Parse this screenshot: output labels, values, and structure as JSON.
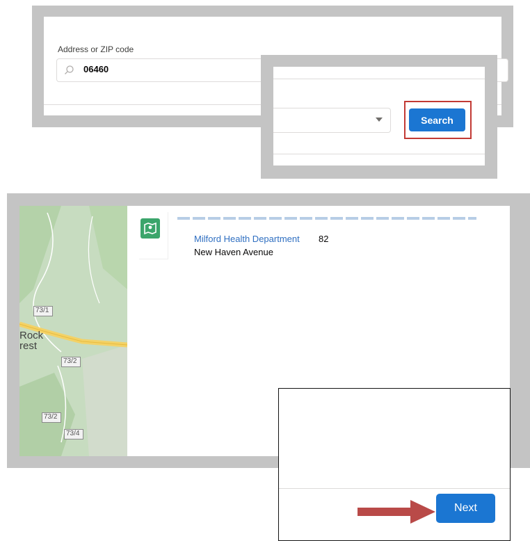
{
  "address_search": {
    "label": "Address or ZIP code",
    "value": "06460",
    "icon": "search-icon"
  },
  "radius_select": {
    "selected": "",
    "icon": "caret-down-icon"
  },
  "search_button": {
    "label": "Search",
    "highlight_color": "#c23934"
  },
  "map": {
    "place_label_1": "Rock",
    "place_label_2": "rest",
    "route_shields": [
      "73/1",
      "73/2",
      "73/2",
      "73/4"
    ]
  },
  "result": {
    "icon": "location-icon",
    "name": "Milford Health Department",
    "number": "82",
    "street": "New Haven Avenue"
  },
  "footer": {
    "next_label": "Next",
    "arrow_color": "#b94a48"
  },
  "colors": {
    "brand_blue": "#1b76d2",
    "link_blue": "#2f6fc1",
    "icon_green": "#3ba56b",
    "frame_gray": "#c4c4c4"
  }
}
